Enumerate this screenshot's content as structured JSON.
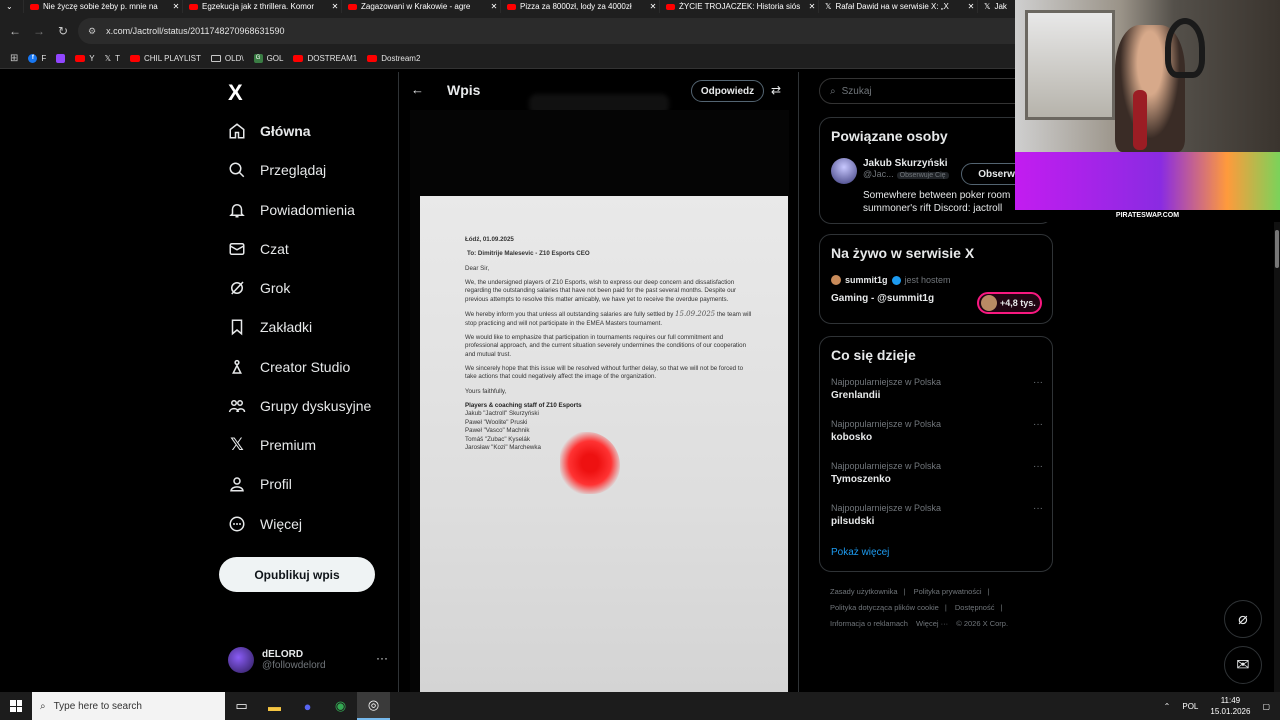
{
  "browser": {
    "tabs": [
      {
        "title": "Nie życzę sobie żeby p. mnie na"
      },
      {
        "title": "Egzekucja jak z thrillera. Komor"
      },
      {
        "title": "Zagazowani w Krakowie - agre"
      },
      {
        "title": "Pizza za 8000zł, lody za 4000zł"
      },
      {
        "title": "ŻYCIE TROJACZEK: Historia siós"
      },
      {
        "title": "Rafał Dawid на w serwisie X: „X"
      },
      {
        "title": "Jak"
      }
    ],
    "url": "x.com/Jactroll/status/2011748270968631590",
    "bookmarks": [
      {
        "label": "F",
        "icon": "facebook-icon"
      },
      {
        "label": "",
        "icon": "twitch-icon"
      },
      {
        "label": "Y",
        "icon": "youtube-icon"
      },
      {
        "label": "T",
        "icon": "x-icon"
      },
      {
        "label": "CHIL PLAYLIST",
        "icon": "youtube-icon"
      },
      {
        "label": "OLD\\",
        "icon": "folder-icon"
      },
      {
        "label": "GOL",
        "icon": "gol-icon"
      },
      {
        "label": "DOSTREAM1",
        "icon": "youtube-icon"
      },
      {
        "label": "Dostream2",
        "icon": "youtube-icon"
      }
    ]
  },
  "nav": {
    "logo": "X",
    "items": [
      {
        "label": "Główna",
        "icon": "home-icon"
      },
      {
        "label": "Przeglądaj",
        "icon": "search-icon"
      },
      {
        "label": "Powiadomienia",
        "icon": "bell-icon"
      },
      {
        "label": "Czat",
        "icon": "mail-icon"
      },
      {
        "label": "Grok",
        "icon": "grok-icon"
      },
      {
        "label": "Zakładki",
        "icon": "bookmark-icon"
      },
      {
        "label": "Creator Studio",
        "icon": "creator-icon"
      },
      {
        "label": "Grupy dyskusyjne",
        "icon": "groups-icon"
      },
      {
        "label": "Premium",
        "icon": "x-icon"
      },
      {
        "label": "Profil",
        "icon": "person-icon"
      },
      {
        "label": "Więcej",
        "icon": "more-circle-icon"
      }
    ],
    "post_button": "Opublikuj wpis",
    "account": {
      "name": "dELORD",
      "handle": "@followdelord"
    }
  },
  "main": {
    "title": "Wpis",
    "reply_button": "Odpowiedz",
    "document": {
      "date": "Łódź, 01.09.2025",
      "to": "To: Dimitrije Malesevic - Z10 Esports CEO",
      "greeting": "Dear Sir,",
      "p1": "We, the undersigned players of Z10 Esports, wish to express our deep concern and dissatisfaction regarding the outstanding salaries that have not been paid for the past several months. Despite our previous attempts to resolve this matter amicably, we have yet to receive the overdue payments.",
      "p2a": "We hereby inform you that unless all outstanding salaries are fully settled by",
      "p2_date": "15.09.2025",
      "p2b": "the team will stop practicing and will not participate in the EMEA Masters tournament.",
      "p3": "We would like to emphasize that participation in tournaments requires our full commitment and professional approach, and the current situation severely undermines the conditions of our cooperation and mutual trust.",
      "p4": "We sincerely hope that this issue will be resolved without further delay, so that we will not be forced to take actions that could negatively affect the image of the organization.",
      "closing": "Yours faithfully,",
      "sign_head": "Players & coaching staff of Z10 Esports",
      "signers": [
        "Jakub \"Jactroll\" Skurzyński",
        "Paweł \"Woolite\" Pruski",
        "Paweł \"Vasco\" Machnik",
        "Tomáš \"Zubac\" Kyselák",
        "Jarosław \"Kozi\" Marchewka"
      ]
    }
  },
  "sidebar": {
    "search_placeholder": "Szukaj",
    "related": {
      "title": "Powiązane osoby",
      "name": "Jakub Skurzyński",
      "handle": "@Jac...",
      "badge": "Obserwuje Cię",
      "follow": "Obserwuj",
      "bio": "Somewhere between poker room summoner's rift Discord: jactroll"
    },
    "live": {
      "title": "Na żywo w serwisie X",
      "host": "summit1g",
      "host_label": "jest hostem",
      "stream_title": "Gaming - @summit1g",
      "listeners": "+4,8 tys."
    },
    "trends": {
      "title": "Co się dzieje",
      "items": [
        {
          "context": "Najpopularniejsze w Polska",
          "name": "Grenlandii"
        },
        {
          "context": "Najpopularniejsze w Polska",
          "name": "kobosko"
        },
        {
          "context": "Najpopularniejsze w Polska",
          "name": "Tymoszenko"
        },
        {
          "context": "Najpopularniejsze w Polska",
          "name": "pilsudski"
        }
      ],
      "show_more": "Pokaż więcej"
    },
    "footer": [
      "Zasady użytkownika",
      "|",
      "Polityka prywatności",
      "|",
      "Polityka dotycząca plików cookie",
      "|",
      "Dostępność",
      "|",
      "Informacja o reklamach",
      "Więcej ···",
      "© 2026 X Corp."
    ]
  },
  "overlay": {
    "banner_text": "PIRATESWAP.COM"
  },
  "taskbar": {
    "search_placeholder": "Type here to search",
    "lang": "POL",
    "time": "11:49",
    "date": "15.01.2026"
  }
}
